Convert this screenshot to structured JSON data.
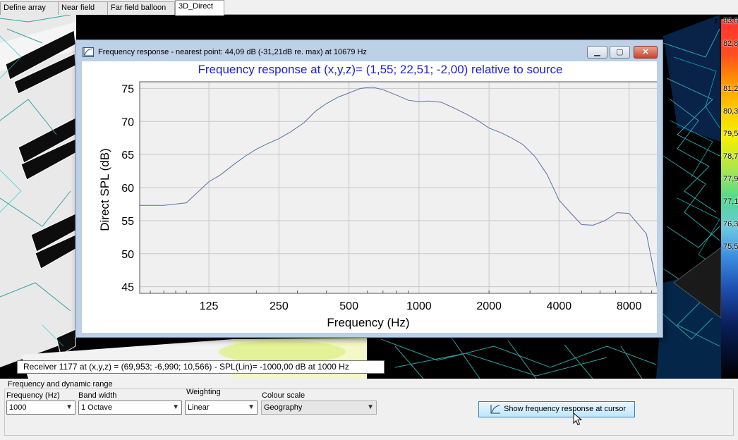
{
  "tabs": [
    {
      "label": "Define array"
    },
    {
      "label": "Near field"
    },
    {
      "label": "Far field balloon"
    },
    {
      "label": "3D_Direct",
      "active": true
    }
  ],
  "colorbar": {
    "unit_fragment": "z",
    "labels": [
      "83,6",
      "82,8",
      "81,2",
      "80,3",
      "79,5",
      "78,7",
      "77,9",
      "77,1",
      "76,3",
      "75,5"
    ]
  },
  "fr_window": {
    "title": "Frequency response - nearest point: 44,09 dB (-31,21dB re. max) at 10679 Hz",
    "buttons": {
      "minimize": "▁",
      "maximize": "▢",
      "close": "✕"
    },
    "colors": {
      "curve": "#5a6fa8",
      "title": "#1f1fd0",
      "plot_bg": "#f0f0f0",
      "grid": "#c8c8c8"
    }
  },
  "chart_data": {
    "type": "line",
    "title": "Frequency response at (x,y,z)= (1,55; 22,51; -2,00) relative to source",
    "xlabel": "Frequency (Hz)",
    "ylabel": "Direct SPL (dB)",
    "x_scale": "log",
    "xlim": [
      63,
      10679
    ],
    "ylim": [
      44,
      76
    ],
    "x_ticks": [
      125,
      250,
      500,
      1000,
      2000,
      4000,
      8000
    ],
    "x_tick_labels": [
      "125",
      "250",
      "500",
      "1000",
      "2000",
      "4000",
      "8000"
    ],
    "y_ticks": [
      45,
      50,
      55,
      60,
      65,
      70,
      75
    ],
    "grid": true,
    "series": [
      {
        "x": [
          63,
          80,
          100,
          125,
          140,
          160,
          180,
          200,
          225,
          250,
          280,
          320,
          360,
          400,
          450,
          500,
          560,
          630,
          700,
          800,
          900,
          1000,
          1100,
          1250,
          1400,
          1600,
          1800,
          2000,
          2250,
          2500,
          2800,
          3150,
          3550,
          4000,
          4500,
          5000,
          5600,
          6300,
          7100,
          8000,
          8500,
          9500,
          10679
        ],
        "y": [
          57.3,
          57.3,
          57.7,
          60.9,
          61.9,
          63.5,
          64.8,
          65.8,
          66.7,
          67.4,
          68.4,
          69.8,
          71.6,
          72.7,
          73.7,
          74.3,
          75.0,
          75.2,
          74.8,
          74.0,
          73.2,
          73.0,
          73.1,
          72.9,
          72.1,
          71.1,
          70.1,
          69.0,
          68.3,
          67.5,
          66.5,
          64.7,
          62.0,
          58.1,
          56.1,
          54.4,
          54.3,
          55.0,
          56.2,
          56.1,
          55.0,
          53.0,
          44.1
        ]
      }
    ]
  },
  "status": {
    "receiver_text": "Receiver 1177 at (x,y,z) = (69,953; -6,990; 10,566) - SPL(Lin)= -1000,00 dB at 1000 Hz"
  },
  "controls": {
    "group_title": "Frequency and dynamic range",
    "frequency": {
      "label": "Frequency (Hz)",
      "value": "1000"
    },
    "band_width": {
      "label": "Band width",
      "value": "1 Octave"
    },
    "weighting": {
      "label": "Weighting",
      "value": "Linear"
    },
    "colour_scale": {
      "label": "Colour scale",
      "value": "Geography"
    },
    "show_button": "Show frequency response at cursor"
  }
}
